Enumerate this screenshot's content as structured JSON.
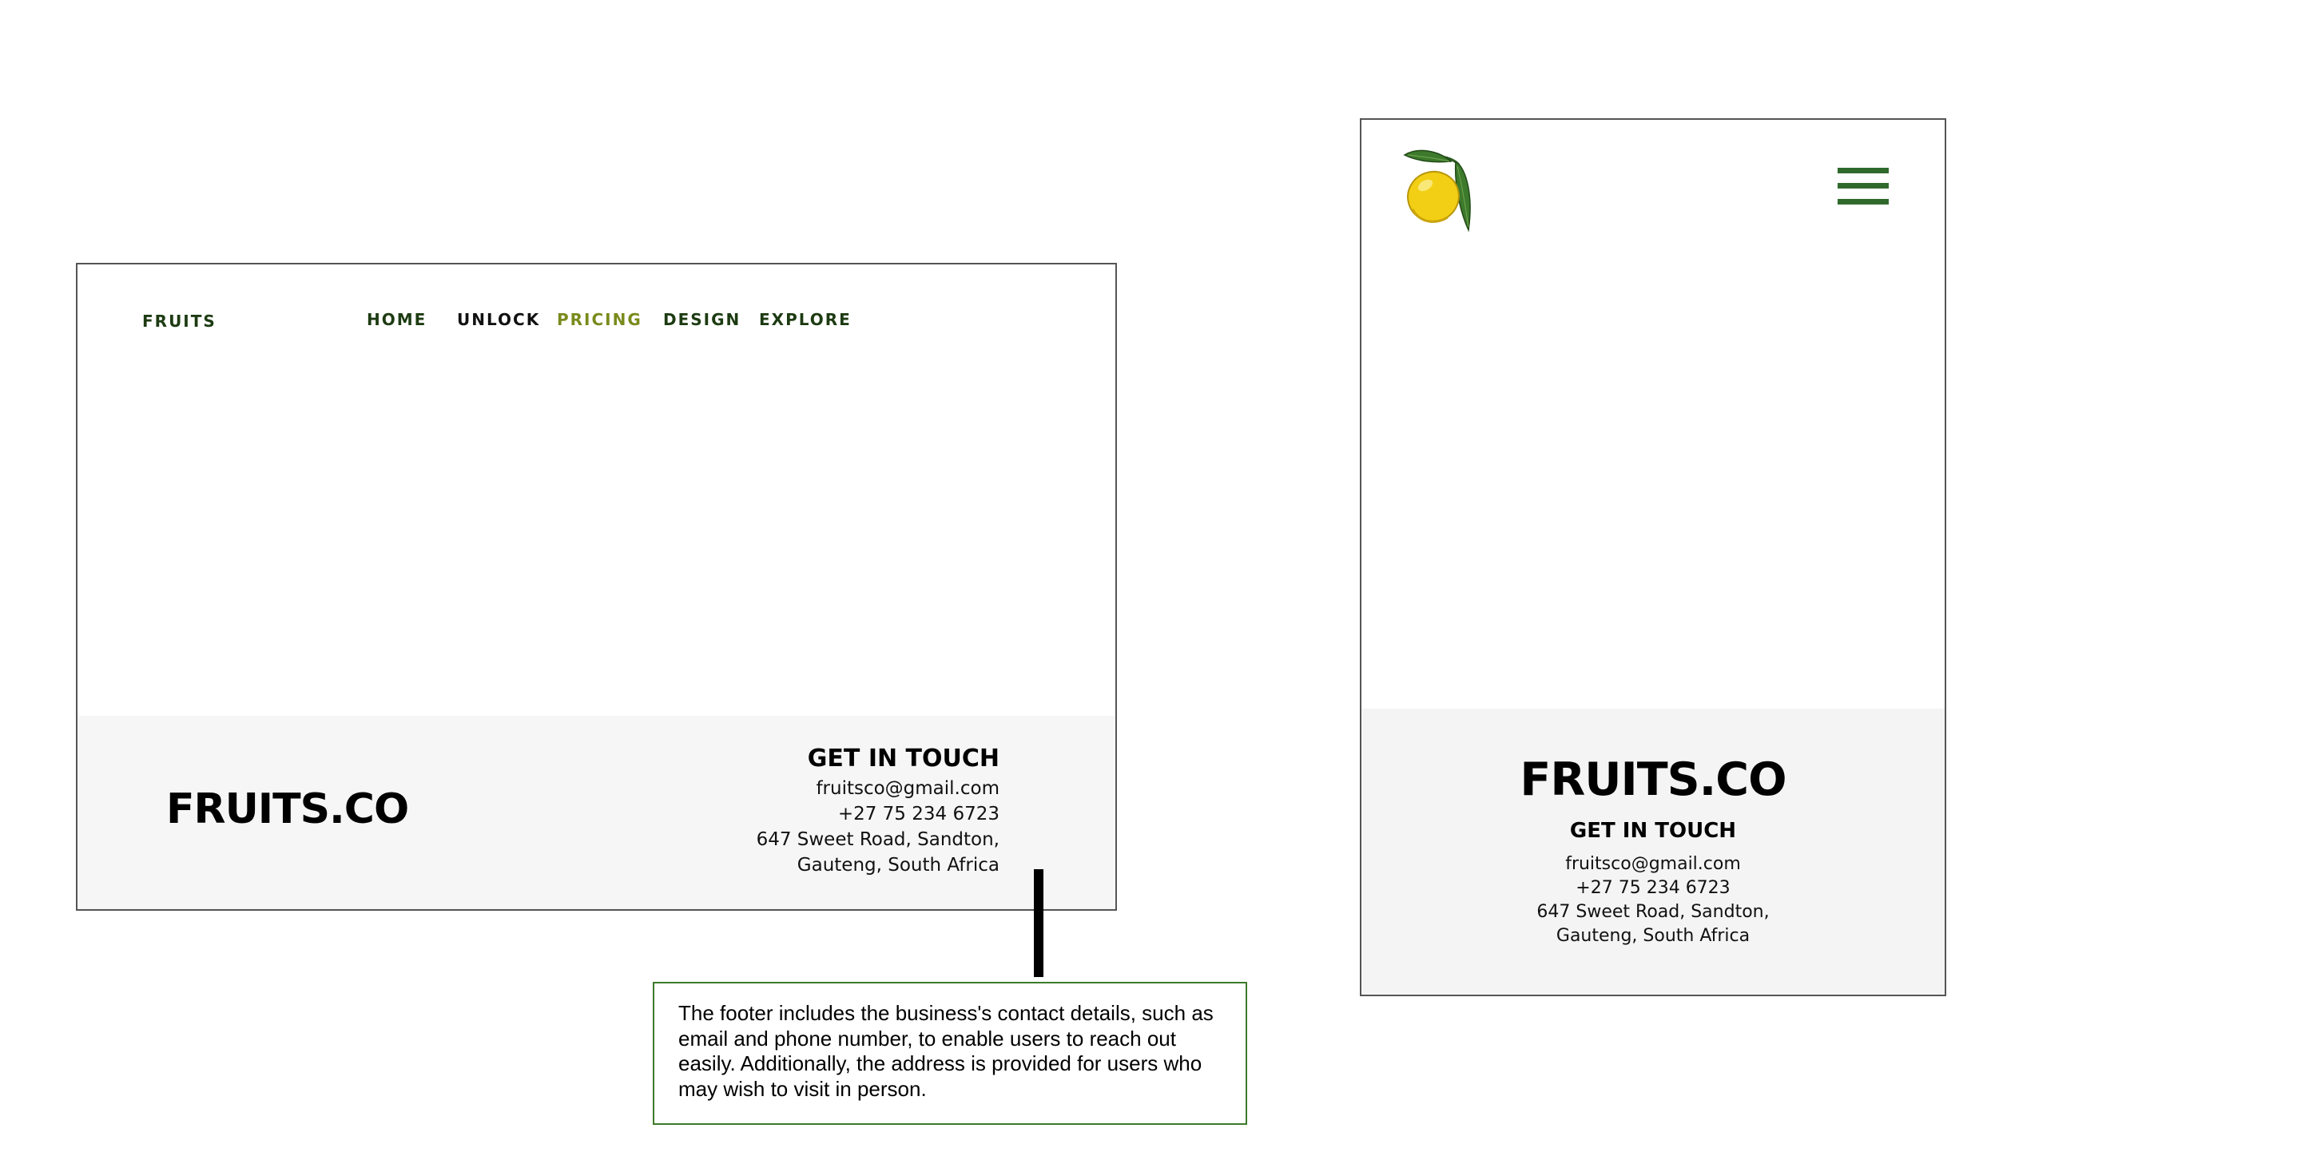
{
  "desktop": {
    "logo": "FRUITS",
    "nav": [
      {
        "label": "HOME"
      },
      {
        "label": "UNLOCK"
      },
      {
        "label": "PRICING"
      },
      {
        "label": "DESIGN"
      },
      {
        "label": "EXPLORE"
      }
    ],
    "footer": {
      "brand": "FRUITS.CO",
      "heading": "GET IN TOUCH",
      "email": "fruitsco@gmail.com",
      "phone": "+27 75 234 6723",
      "address_line1": "647 Sweet Road, Sandton,",
      "address_line2": "Gauteng, South Africa"
    }
  },
  "callout": {
    "text": "The footer includes the business's contact details, such as email and phone number, to enable users to reach out easily. Additionally, the address is provided for users who may wish to visit in person."
  },
  "mobile": {
    "logo_icon": "lemon-icon",
    "menu_icon": "hamburger-menu-icon",
    "footer": {
      "brand": "FRUITS.CO",
      "heading": "GET IN TOUCH",
      "email": "fruitsco@gmail.com",
      "phone": "+27 75 234 6723",
      "address_line1": "647 Sweet Road, Sandton,",
      "address_line2": "Gauteng, South Africa"
    }
  },
  "colors": {
    "nav_text": "#1d3b12",
    "nav_active": "#7a8a1c",
    "footer_bg": "#f6f6f6",
    "callout_border": "#3c7a2a",
    "hamburger": "#2f6a2c",
    "lemon": "#f2cf14",
    "leaf": "#3d7a2c"
  }
}
